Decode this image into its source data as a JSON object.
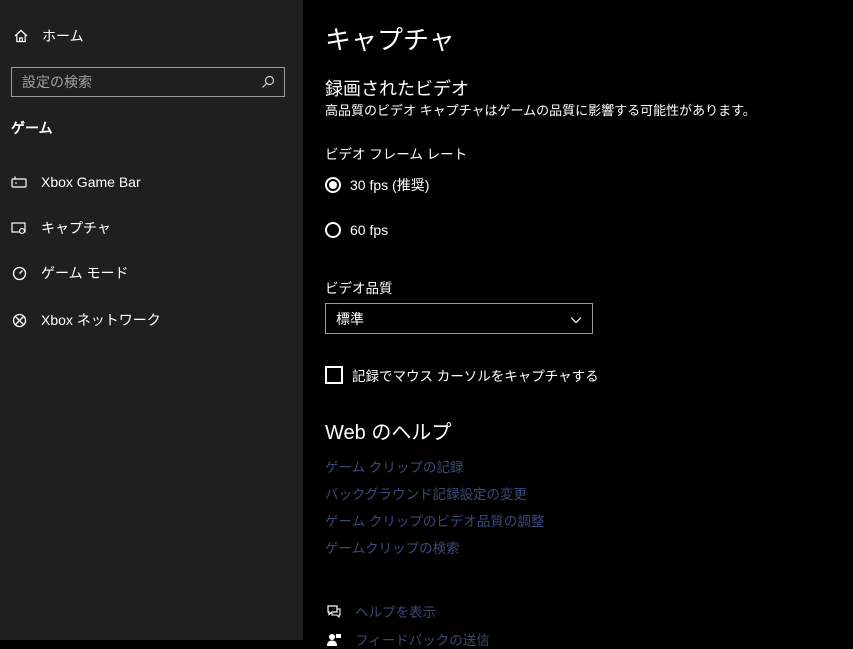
{
  "sidebar": {
    "home_label": "ホーム",
    "search_placeholder": "設定の検索",
    "section_title": "ゲーム",
    "items": [
      {
        "label": "Xbox Game Bar",
        "icon": "game-bar-icon"
      },
      {
        "label": "キャプチャ",
        "icon": "capture-icon"
      },
      {
        "label": "ゲーム モード",
        "icon": "game-mode-icon"
      },
      {
        "label": "Xbox ネットワーク",
        "icon": "xbox-icon"
      }
    ]
  },
  "main": {
    "title": "キャプチャ",
    "recorded_video": {
      "title": "録画されたビデオ",
      "description": "高品質のビデオ キャプチャはゲームの品質に影響する可能性があります。"
    },
    "frame_rate": {
      "label": "ビデオ フレーム レート",
      "options": [
        "30 fps (推奨)",
        "60 fps"
      ],
      "selected": "30 fps (推奨)"
    },
    "quality": {
      "label": "ビデオ品質",
      "value": "標準"
    },
    "cursor_checkbox": {
      "label": "記録でマウス カーソルをキャプチャする",
      "checked": false
    },
    "help": {
      "title": "Web のヘルプ",
      "links": [
        "ゲーム クリップの記録",
        "バックグラウンド記録設定の変更",
        "ゲーム クリップのビデオ品質の調整",
        "ゲームクリップの検索"
      ]
    },
    "bottom_links": [
      {
        "label": "ヘルプを表示",
        "icon": "help-chat-icon"
      },
      {
        "label": "フィードバックの送信",
        "icon": "feedback-icon"
      }
    ]
  },
  "colors": {
    "sidebar_bg": "#1f1f1f",
    "main_bg": "#000000",
    "link": "#3a4a78"
  }
}
